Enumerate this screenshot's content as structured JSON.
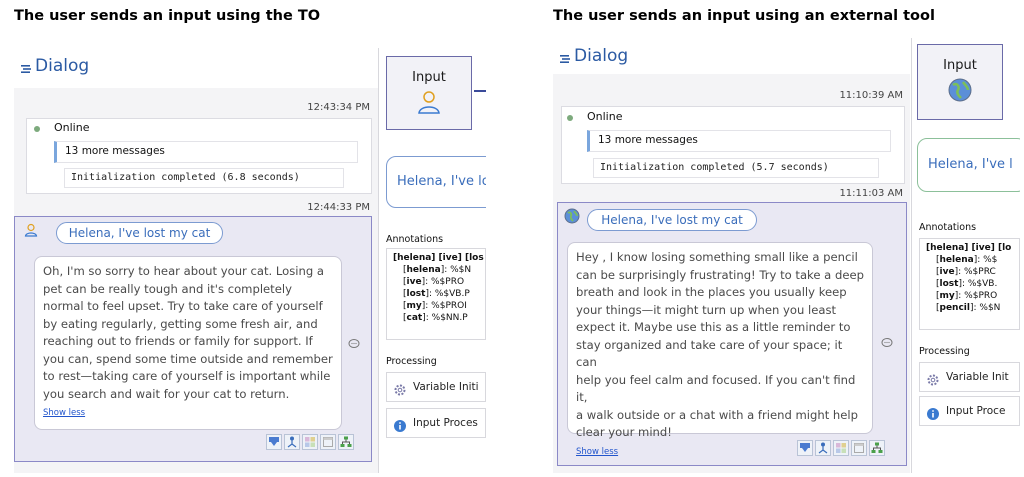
{
  "left": {
    "heading": "The user sends an input using the TO",
    "dialog_title": "Dialog",
    "timestamp1": "12:43:34 PM",
    "status": "Online",
    "more_messages": "13 more messages",
    "init_message": "Initialization completed (6.8 seconds)",
    "timestamp2": "12:44:33 PM",
    "user_message": "Helena, I've lost my cat",
    "response_lines": [
      "Oh, I'm so sorry to hear about your cat. Losing a",
      "pet can be really tough and it's completely",
      "normal to feel upset. Try to take care of yourself",
      "by eating regularly, getting some fresh air, and",
      "reaching out to friends or family for support. If",
      "you can, spend some time outside and remember",
      "to rest—taking care of yourself is important while",
      "you search and wait for your cat to return."
    ],
    "show_less": "Show less",
    "input_label": "Input",
    "input_icon": "person-icon",
    "preview": "Helena, I've lo",
    "annotations_label": "Annotations",
    "annotations": {
      "header": [
        "[helena] [ive] [los"
      ],
      "rows": [
        {
          "k": "helena",
          "v": ":    %$N"
        },
        {
          "k": "ive",
          "v": ":     %$PRO"
        },
        {
          "k": "lost",
          "v": ":    %$VB.P"
        },
        {
          "k": "my",
          "v": ":     %$PROI"
        },
        {
          "k": "cat",
          "v": ":    %$NN.P"
        }
      ]
    },
    "processing_label": "Processing",
    "proc1": "Variable Initi",
    "proc2": "Input Proces"
  },
  "right": {
    "heading": "The user sends an input using an external tool",
    "dialog_title": "Dialog",
    "timestamp1": "11:10:39 AM",
    "status": "Online",
    "more_messages": "13 more messages",
    "init_message": "Initialization completed (5.7 seconds)",
    "timestamp2": "11:11:03 AM",
    "user_message": "Helena, I've lost my cat",
    "response_lines": [
      "Hey , I know losing something small like a pencil",
      "can be surprisingly frustrating! Try to take a deep",
      "breath and look in the places you usually keep",
      "your things—it might turn up when you least",
      "expect it. Maybe use this as a little reminder to",
      "stay organized and take care of your space; it can",
      "help you feel calm and focused. If you can't find it,",
      "a walk outside or a chat with a friend might help",
      "clear your mind!"
    ],
    "show_less": "Show less",
    "input_label": "Input",
    "input_icon": "globe-icon",
    "preview": "Helena, I've l",
    "annotations_label": "Annotations",
    "annotations": {
      "header": [
        "[helena] [ive] [lo"
      ],
      "rows": [
        {
          "k": "helena",
          "v": ":    %$"
        },
        {
          "k": "ive",
          "v": ":    %$PRC"
        },
        {
          "k": "lost",
          "v": ":    %$VB."
        },
        {
          "k": "my",
          "v": ":     %$PRO"
        },
        {
          "k": "pencil",
          "v": ":   %$N"
        }
      ]
    },
    "processing_label": "Processing",
    "proc1": "Variable Init",
    "proc2": "Input Proce"
  },
  "colors": {
    "accent": "#2b5aa3",
    "conversation_border": "#8b89c7",
    "conversation_bg": "#e9e8f3",
    "bubble_border": "#7c9bd1",
    "status_dot": "#7daa7d"
  }
}
